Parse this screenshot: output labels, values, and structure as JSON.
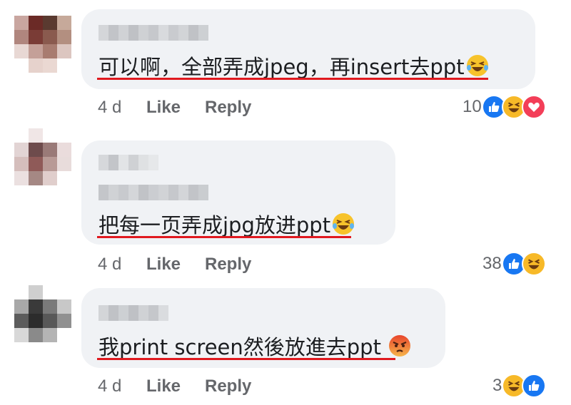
{
  "comments": [
    {
      "text_parts": [
        "可以啊，全部弄成",
        "jpeg",
        "，再",
        "insert",
        "去",
        "ppt"
      ],
      "text": "可以啊，全部弄成jpeg，再insert去ppt",
      "inline_emoji": "laughing-tears-emoji",
      "time": "4 d",
      "like_label": "Like",
      "reply_label": "Reply",
      "reaction_count": "10",
      "reactions": [
        "like",
        "haha",
        "love"
      ]
    },
    {
      "text": "把每一页弄成jpg放进ppt",
      "inline_emoji": "laughing-tears-emoji",
      "time": "4 d",
      "like_label": "Like",
      "reply_label": "Reply",
      "reaction_count": "38",
      "reactions": [
        "like",
        "haha"
      ]
    },
    {
      "text": "我print screen然後放進去ppt",
      "inline_emoji": "angry-emoji",
      "time": "4 d",
      "like_label": "Like",
      "reply_label": "Reply",
      "reaction_count": "3",
      "reactions": [
        "haha",
        "like"
      ]
    }
  ],
  "colors": {
    "bubble": "#f0f2f5",
    "underline": "#e0191f",
    "meta": "#65676b",
    "like": "#1877f2",
    "haha": "#f7b928",
    "love": "#f33e58"
  }
}
